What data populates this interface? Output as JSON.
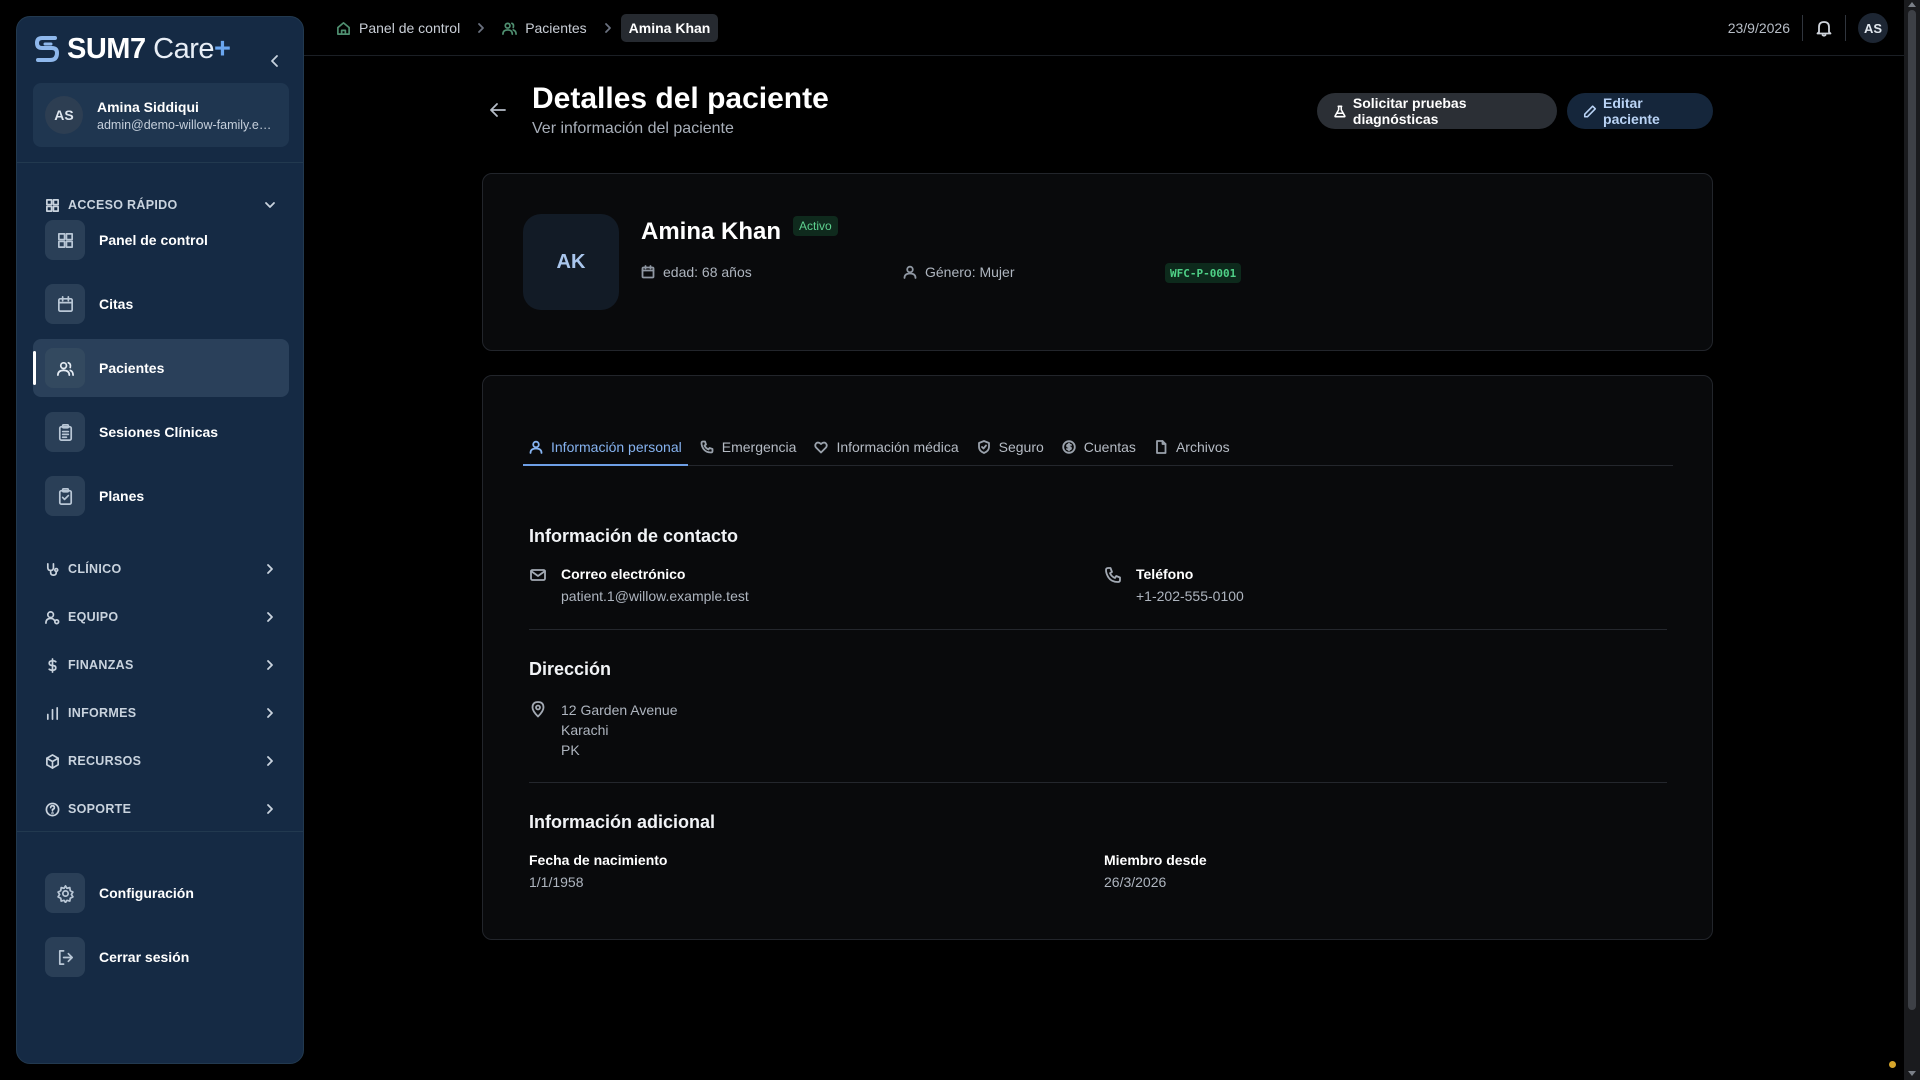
{
  "app": {
    "logo_brand": "SUM7",
    "logo_product": "Care",
    "logo_plus": "+"
  },
  "user": {
    "initials": "AS",
    "name": "Amina Siddiqui",
    "email": "admin@demo-willow-family.ex..."
  },
  "sidebar": {
    "quick_access_label": "ACCESO RÁPIDO",
    "items": [
      {
        "label": "Panel de control",
        "icon": "dashboard-icon"
      },
      {
        "label": "Citas",
        "icon": "calendar-icon"
      },
      {
        "label": "Pacientes",
        "icon": "users-icon",
        "active": true
      },
      {
        "label": "Sesiones Clínicas",
        "icon": "clipboard-icon"
      },
      {
        "label": "Planes",
        "icon": "clipboard-check-icon"
      }
    ],
    "sections": [
      {
        "label": "CLÍNICO",
        "icon": "stethoscope-icon"
      },
      {
        "label": "EQUIPO",
        "icon": "user-gear-icon"
      },
      {
        "label": "FINANZAS",
        "icon": "dollar-icon"
      },
      {
        "label": "INFORMES",
        "icon": "bar-chart-icon"
      },
      {
        "label": "RECURSOS",
        "icon": "package-icon"
      },
      {
        "label": "SOPORTE",
        "icon": "help-circle-icon"
      }
    ],
    "settings_label": "Configuración",
    "logout_label": "Cerrar sesión"
  },
  "breadcrumbs": [
    {
      "label": "Panel de control",
      "icon": "home-icon"
    },
    {
      "label": "Pacientes",
      "icon": "users-icon"
    },
    {
      "label": "Amina Khan"
    }
  ],
  "topbar": {
    "date": "23/9/2026",
    "avatar_initials": "AS"
  },
  "page": {
    "title": "Detalles del paciente",
    "subtitle": "Ver información del paciente",
    "btn_tests": "Solicitar pruebas diagnósticas",
    "btn_edit": "Editar paciente"
  },
  "patient": {
    "initials": "AK",
    "name": "Amina Khan",
    "status": "Activo",
    "age": "edad: 68 años",
    "gender": "Género: Mujer",
    "id": "WFC-P-0001"
  },
  "tabs": [
    {
      "label": "Información personal",
      "icon": "user-icon",
      "active": true
    },
    {
      "label": "Emergencia",
      "icon": "phone-icon"
    },
    {
      "label": "Información médica",
      "icon": "heart-icon"
    },
    {
      "label": "Seguro",
      "icon": "shield-icon"
    },
    {
      "label": "Cuentas",
      "icon": "dollar-circle-icon"
    },
    {
      "label": "Archivos",
      "icon": "file-icon"
    }
  ],
  "contact": {
    "title": "Información de contacto",
    "email_label": "Correo electrónico",
    "email_value": "patient.1@willow.example.test",
    "phone_label": "Teléfono",
    "phone_value": "+1-202-555-0100"
  },
  "address": {
    "title": "Dirección",
    "line1": "12 Garden Avenue",
    "line2": "Karachi",
    "line3": "PK"
  },
  "additional": {
    "title": "Información adicional",
    "dob_label": "Fecha de nacimiento",
    "dob_value": "1/1/1958",
    "member_label": "Miembro desde",
    "member_value": "26/3/2026"
  },
  "colors": {
    "sidebar_bg": "#152a44",
    "accent": "#86b3f0",
    "active_green": "#5ed28f"
  }
}
